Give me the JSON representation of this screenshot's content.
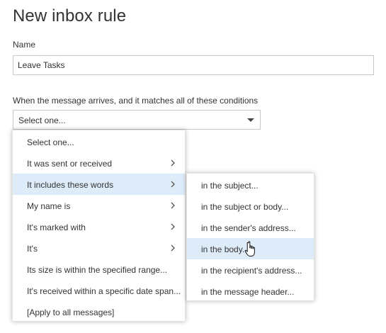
{
  "page_title": "New inbox rule",
  "name_field": {
    "label": "Name",
    "value": "Leave Tasks"
  },
  "conditions": {
    "label": "When the message arrives, and it matches all of these conditions",
    "selected": "Select one..."
  },
  "main_menu": {
    "items": [
      {
        "label": "Select one...",
        "has_submenu": false,
        "highlighted": false
      },
      {
        "label": "It was sent or received",
        "has_submenu": true,
        "highlighted": false
      },
      {
        "label": "It includes these words",
        "has_submenu": true,
        "highlighted": true
      },
      {
        "label": "My name is",
        "has_submenu": true,
        "highlighted": false
      },
      {
        "label": "It's marked with",
        "has_submenu": true,
        "highlighted": false
      },
      {
        "label": "It's",
        "has_submenu": true,
        "highlighted": false
      },
      {
        "label": "Its size is within the specified range...",
        "has_submenu": false,
        "highlighted": false
      },
      {
        "label": "It's received within a specific date span...",
        "has_submenu": false,
        "highlighted": false
      },
      {
        "label": "[Apply to all messages]",
        "has_submenu": false,
        "highlighted": false
      }
    ]
  },
  "sub_menu": {
    "items": [
      {
        "label": "in the subject...",
        "highlighted": false
      },
      {
        "label": "in the subject or body...",
        "highlighted": false
      },
      {
        "label": "in the sender's address...",
        "highlighted": false
      },
      {
        "label": "in the body...",
        "highlighted": true
      },
      {
        "label": "in the recipient's address...",
        "highlighted": false
      },
      {
        "label": "in the message header...",
        "highlighted": false
      }
    ]
  },
  "icons": {
    "dropdown_caret": "chevron-down-icon",
    "submenu_arrow": "chevron-right-icon",
    "cursor": "hand-pointer-icon"
  },
  "colors": {
    "highlight": "#deecf9",
    "text": "#333333",
    "border": "#c8c8c8"
  }
}
